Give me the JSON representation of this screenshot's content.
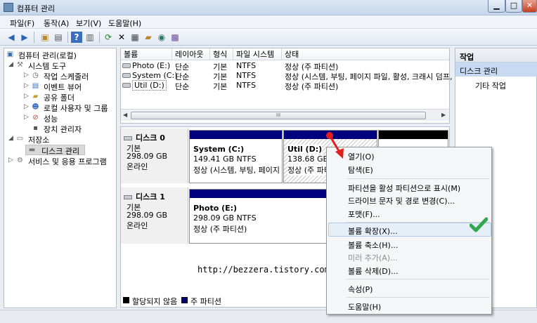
{
  "window": {
    "title": "컴퓨터 관리"
  },
  "menu": [
    "파일(F)",
    "동작(A)",
    "보기(V)",
    "도움말(H)"
  ],
  "tree": [
    {
      "label": "컴퓨터 관리(로컬)",
      "icon": "computer-icon"
    },
    {
      "label": "시스템 도구",
      "icon": "tools-icon"
    },
    {
      "label": "작업 스케줄러",
      "icon": "clock-icon"
    },
    {
      "label": "이벤트 뷰어",
      "icon": "event-viewer-icon"
    },
    {
      "label": "공유 폴더",
      "icon": "shared-folder-icon"
    },
    {
      "label": "로컬 사용자 및 그룹",
      "icon": "users-icon"
    },
    {
      "label": "성능",
      "icon": "performance-icon"
    },
    {
      "label": "장치 관리자",
      "icon": "device-manager-icon"
    },
    {
      "label": "저장소",
      "icon": "storage-icon"
    },
    {
      "label": "디스크 관리",
      "icon": "disk-management-icon"
    },
    {
      "label": "서비스 및 응용 프로그램",
      "icon": "services-icon"
    }
  ],
  "volume_list": {
    "columns": [
      "볼륨",
      "레이아웃",
      "형식",
      "파일 시스템",
      "상태"
    ],
    "rows": [
      {
        "volume": "Photo (E:)",
        "layout": "단순",
        "type": "기본",
        "fs": "NTFS",
        "status": "정상 (주 파티션)"
      },
      {
        "volume": "System (C:)",
        "layout": "단순",
        "type": "기본",
        "fs": "NTFS",
        "status": "정상 (시스템, 부팅, 페이지 파일, 활성, 크래시 덤프,"
      },
      {
        "volume": "Util (D:)",
        "layout": "단순",
        "type": "기본",
        "fs": "NTFS",
        "status": "정상 (주 파티션)"
      }
    ],
    "scroll_grip": "III"
  },
  "disks": [
    {
      "name": "디스크 0",
      "type": "기본",
      "size": "298.09 GB",
      "status": "온라인",
      "partitions": [
        {
          "name": "System  (C:)",
          "size": "149.41 GB NTFS",
          "status": "정상 (시스템, 부팅, 페이지"
        },
        {
          "name": "Util  (D:)",
          "size": "138.68 GB N",
          "status": "정상 (주 파티"
        }
      ]
    },
    {
      "name": "디스크 1",
      "type": "기본",
      "size": "298.09 GB",
      "status": "온라인",
      "partitions": [
        {
          "name": "Photo  (E:)",
          "size": "298.09 GB NTFS",
          "status": "정상 (주 파티션)"
        }
      ]
    }
  ],
  "watermark": "http://bezzera.tistory.com",
  "legend": [
    {
      "label": "할당되지 않음",
      "color": "#000000"
    },
    {
      "label": "주 파티션",
      "color": "#00007f"
    }
  ],
  "actions": {
    "title": "작업",
    "selected": "디스크 관리",
    "more": "기타 작업"
  },
  "context_menu": {
    "items": [
      "열기(O)",
      "탐색(E)",
      "파티션을 활성 파티션으로 표시(M)",
      "드라이브 문자 및 경로 변경(C)...",
      "포맷(F)...",
      "볼륨 확장(X)...",
      "볼륨 축소(H)...",
      "미러 추가(A)...",
      "볼륨 삭제(D)...",
      "속성(P)",
      "도움말(H)"
    ],
    "disabled": [
      "미러 추가(A)..."
    ],
    "highlighted": "볼륨 확장(X)..."
  },
  "colors": {
    "primary_partition": "#00007f",
    "unallocated": "#000000",
    "check": "#2fa84f",
    "pointer": "#e02020"
  }
}
